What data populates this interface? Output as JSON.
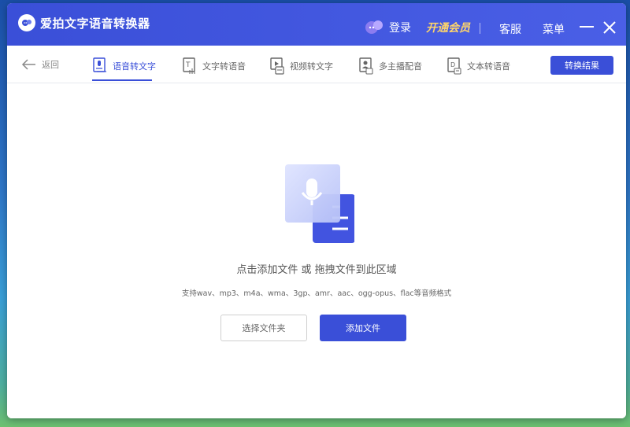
{
  "app": {
    "title": "爱拍文字语音转换器",
    "login": "登录",
    "vip": "开通会员",
    "service": "客服",
    "menu": "菜单"
  },
  "toolbar": {
    "back": "返回",
    "tabs": [
      {
        "label": "语音转文字",
        "icon": "mic-doc-icon",
        "active": true
      },
      {
        "label": "文字转语音",
        "icon": "text-to-audio-icon",
        "active": false
      },
      {
        "label": "视频转文字",
        "icon": "video-doc-icon",
        "active": false
      },
      {
        "label": "多主播配音",
        "icon": "person-doc-icon",
        "active": false
      },
      {
        "label": "文本转语音",
        "icon": "file-doc-icon",
        "active": false
      }
    ],
    "result_button": "转换结果"
  },
  "main": {
    "drop_title": "点击添加文件 或 拖拽文件到此区域",
    "formats": "支持wav、mp3、m4a、wma、3gp、amr、aac、ogg-opus、flac等音频格式",
    "select_folder": "选择文件夹",
    "add_file": "添加文件"
  },
  "colors": {
    "accent": "#3a4fd8",
    "vip": "#ffd66a"
  }
}
